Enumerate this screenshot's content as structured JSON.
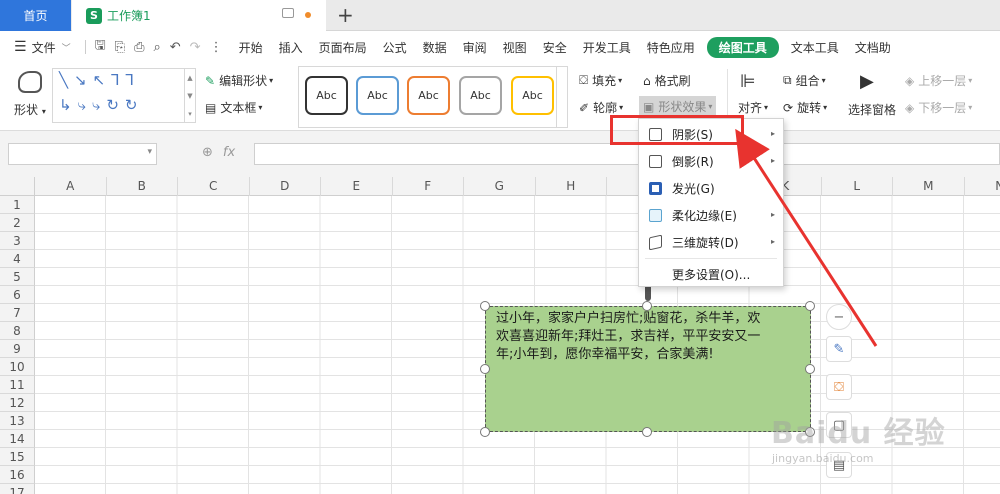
{
  "tabs": {
    "home": "首页",
    "doc": "工作簿1",
    "doc_icon": "S",
    "new": "+"
  },
  "menu": {
    "file": "文件",
    "items": [
      "开始",
      "插入",
      "页面布局",
      "公式",
      "数据",
      "审阅",
      "视图",
      "安全",
      "开发工具",
      "特色应用"
    ],
    "active": "绘图工具",
    "after": [
      "文本工具",
      "文档助"
    ]
  },
  "ribbon": {
    "shape": "形状",
    "edit_shape": "编辑形状",
    "text_frame": "文本框",
    "styles": [
      "Abc",
      "Abc",
      "Abc",
      "Abc",
      "Abc"
    ],
    "style_colors": [
      "#333333",
      "#5b9bd5",
      "#ed7d31",
      "#a5a5a5",
      "#ffc000"
    ],
    "fill": "填充",
    "format_painter": "格式刷",
    "outline": "轮廓",
    "shape_effect": "形状效果",
    "align": "对齐",
    "group": "组合",
    "rotate": "旋转",
    "selection_pane": "选择窗格",
    "bring_forward": "上移一层",
    "send_backward": "下移一层"
  },
  "formula_bar": {
    "fx": "fx"
  },
  "sheet": {
    "columns": [
      "A",
      "B",
      "C",
      "D",
      "E",
      "F",
      "G",
      "H",
      "I",
      "J",
      "K",
      "L",
      "M",
      "N"
    ],
    "rows": [
      "1",
      "2",
      "3",
      "4",
      "5",
      "6",
      "7",
      "8",
      "9",
      "10",
      "11",
      "12",
      "13",
      "14",
      "15",
      "16",
      "17"
    ]
  },
  "textbox": {
    "line1": "过小年，家家户户扫房忙;贴窗花，杀牛羊，欢",
    "line2": "欢喜喜迎新年;拜灶王，求吉祥，平平安安又一",
    "line3": "年;小年到，愿你幸福平安，合家美满!",
    "fill_color": "#a9d18e"
  },
  "dropdown": {
    "items": [
      {
        "label": "阴影(S)",
        "submenu": true,
        "icon_color": "#555555"
      },
      {
        "label": "倒影(R)",
        "submenu": true,
        "icon_color": "#555555"
      },
      {
        "label": "发光(G)",
        "submenu": false,
        "icon_color": "#2b5fb4"
      },
      {
        "label": "柔化边缘(E)",
        "submenu": true,
        "icon_color": "#5ba4cf"
      },
      {
        "label": "三维旋转(D)",
        "submenu": true,
        "icon_color": "#555555"
      }
    ],
    "more": "更多设置(O)..."
  },
  "watermark": {
    "brand": "Baidu 经验",
    "url": "jingyan.baidu.com"
  },
  "accent_colors": {
    "annotation_red": "#e8332f",
    "active_green": "#1e9f5f",
    "home_blue": "#2f76dc"
  }
}
